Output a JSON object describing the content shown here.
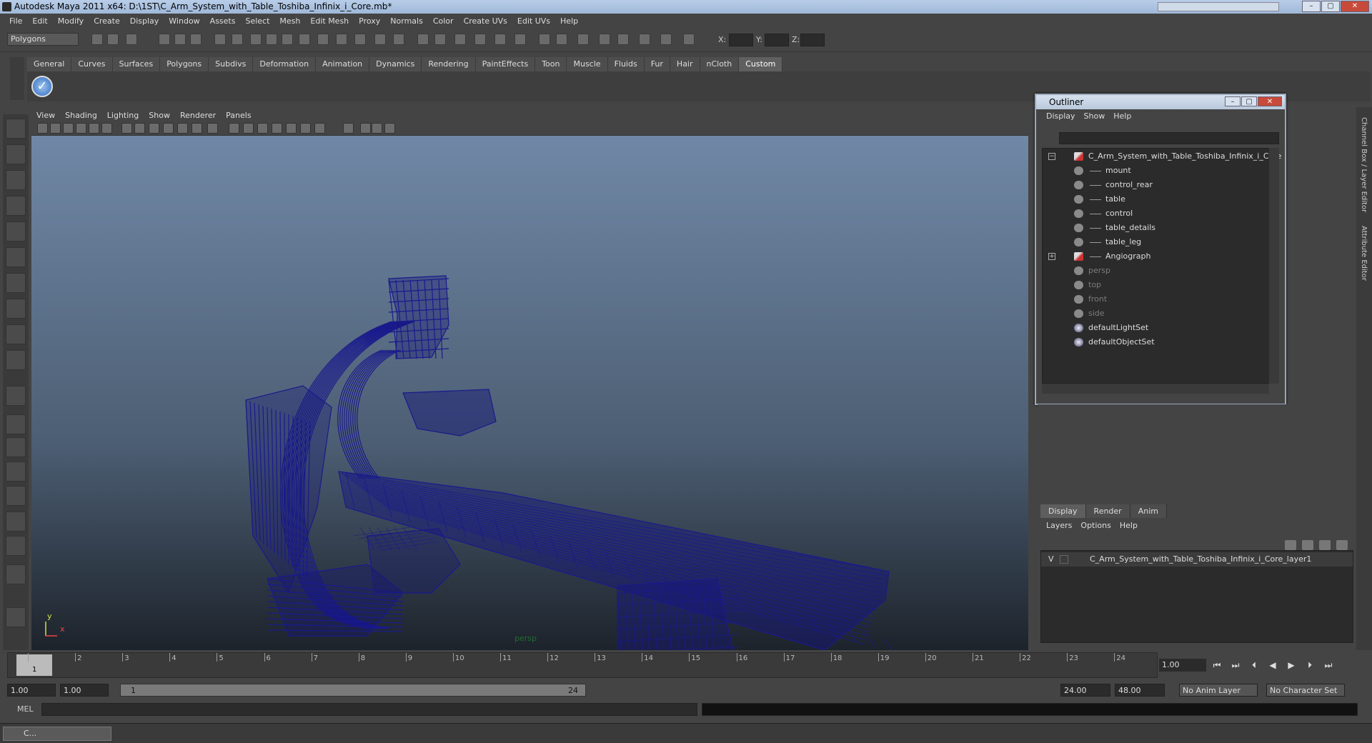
{
  "window": {
    "title": "Autodesk Maya 2011 x64: D:\\1ST\\C_Arm_System_with_Table_Toshiba_Infinix_i_Core.mb*"
  },
  "menubar": [
    "File",
    "Edit",
    "Modify",
    "Create",
    "Display",
    "Window",
    "Assets",
    "Select",
    "Mesh",
    "Edit Mesh",
    "Proxy",
    "Normals",
    "Color",
    "Create UVs",
    "Edit UVs",
    "Help"
  ],
  "statusline": {
    "mode": "Polygons",
    "x_label": "X:",
    "y_label": "Y:",
    "z_label": "Z:"
  },
  "shelf": {
    "tabs": [
      "General",
      "Curves",
      "Surfaces",
      "Polygons",
      "Subdivs",
      "Deformation",
      "Animation",
      "Dynamics",
      "Rendering",
      "PaintEffects",
      "Toon",
      "Muscle",
      "Fluids",
      "Fur",
      "Hair",
      "nCloth",
      "Custom"
    ],
    "active": "Custom"
  },
  "viewport": {
    "menu": [
      "View",
      "Shading",
      "Lighting",
      "Show",
      "Renderer",
      "Panels"
    ],
    "camera_label": "persp",
    "axis_y": "y",
    "axis_x": "x",
    "wire_color": "#1a1a8c"
  },
  "outliner": {
    "title": "Outliner",
    "menu": [
      "Display",
      "Show",
      "Help"
    ],
    "items": [
      {
        "label": "C_Arm_System_with_Table_Toshiba_Infinix_i_Core",
        "indent": 0,
        "type": "mesh",
        "expander": "−",
        "dim": false
      },
      {
        "label": "mount",
        "indent": 1,
        "type": "obj",
        "dim": false
      },
      {
        "label": "control_rear",
        "indent": 1,
        "type": "obj",
        "dim": false
      },
      {
        "label": "table",
        "indent": 1,
        "type": "obj",
        "dim": false
      },
      {
        "label": "control",
        "indent": 1,
        "type": "obj",
        "dim": false
      },
      {
        "label": "table_details",
        "indent": 1,
        "type": "obj",
        "dim": false
      },
      {
        "label": "table_leg",
        "indent": 1,
        "type": "obj",
        "dim": false
      },
      {
        "label": "Angiograph",
        "indent": 1,
        "type": "mesh",
        "expander": "+",
        "dim": false
      },
      {
        "label": "persp",
        "indent": 0,
        "type": "cam",
        "dim": true
      },
      {
        "label": "top",
        "indent": 0,
        "type": "cam",
        "dim": true
      },
      {
        "label": "front",
        "indent": 0,
        "type": "cam",
        "dim": true
      },
      {
        "label": "side",
        "indent": 0,
        "type": "cam",
        "dim": true
      },
      {
        "label": "defaultLightSet",
        "indent": 0,
        "type": "set",
        "dim": false
      },
      {
        "label": "defaultObjectSet",
        "indent": 0,
        "type": "set",
        "dim": false
      }
    ]
  },
  "layers": {
    "tabs": [
      "Display",
      "Render",
      "Anim"
    ],
    "active": "Display",
    "menu": [
      "Layers",
      "Options",
      "Help"
    ],
    "layer_name": "C_Arm_System_with_Table_Toshiba_Infinix_i_Core_layer1",
    "visibility": "V"
  },
  "channel_strip": {
    "channel_box": "Channel Box / Layer Editor",
    "attr_editor": "Attribute Editor"
  },
  "timeline": {
    "ticks": [
      "1",
      "2",
      "3",
      "4",
      "5",
      "6",
      "7",
      "8",
      "9",
      "10",
      "11",
      "12",
      "13",
      "14",
      "15",
      "16",
      "17",
      "18",
      "19",
      "20",
      "21",
      "22",
      "23",
      "24"
    ],
    "current_frame": "1",
    "current_time": "1.00"
  },
  "range": {
    "start": "1.00",
    "anim_start": "1.00",
    "range_min": "1",
    "range_max": "24",
    "end": "24.00",
    "anim_end": "48.00",
    "anim_layer": "No Anim Layer",
    "char_set": "No Character Set"
  },
  "cmdline": {
    "label": "MEL"
  },
  "taskbar": {
    "item": "C..."
  }
}
